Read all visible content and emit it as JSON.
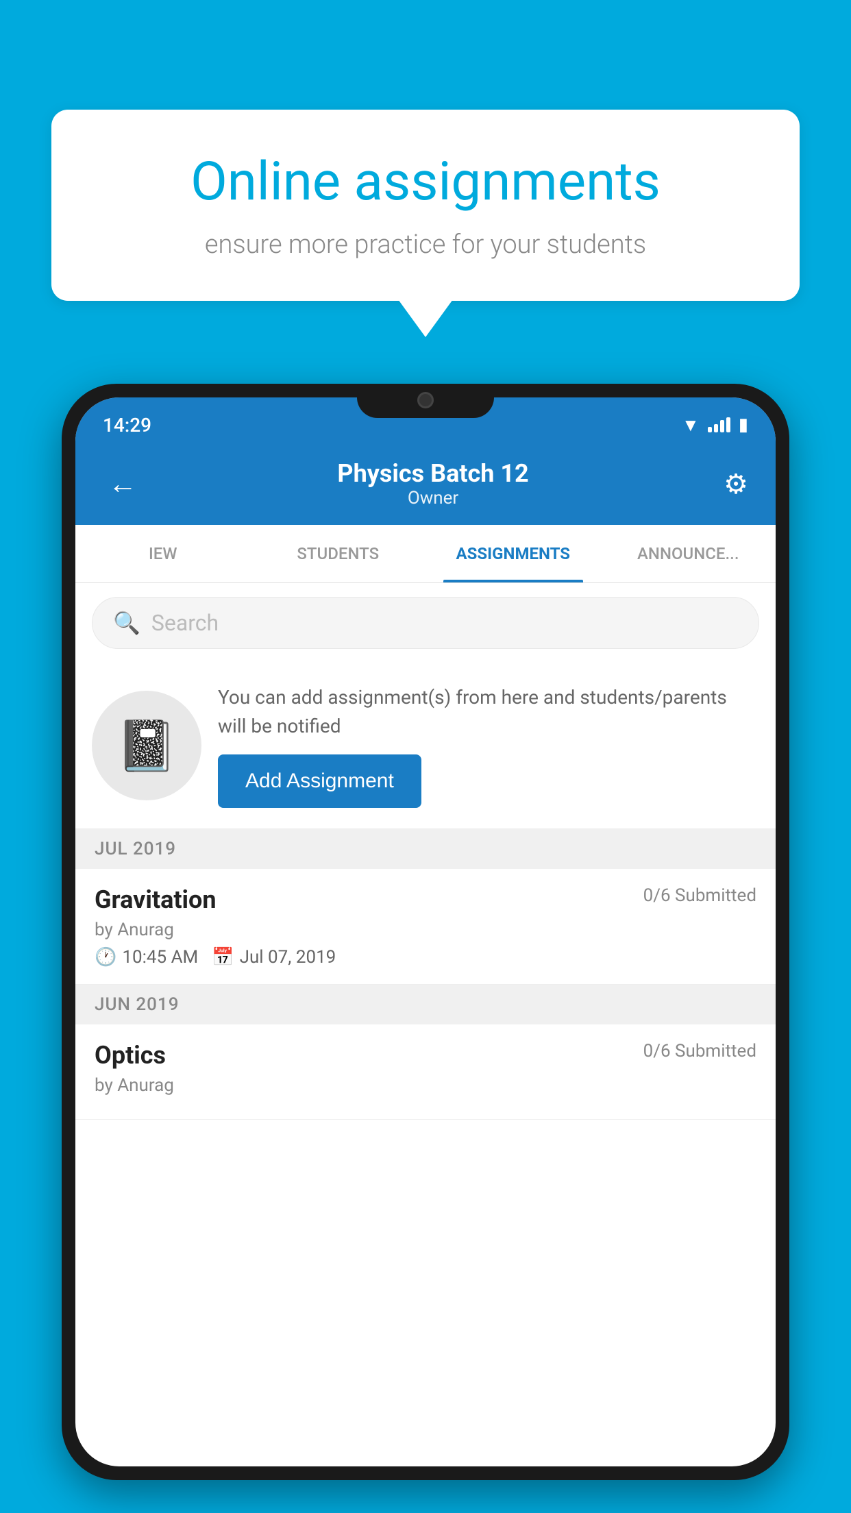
{
  "background_color": "#00AADD",
  "speech_bubble": {
    "title": "Online assignments",
    "subtitle": "ensure more practice for your students"
  },
  "status_bar": {
    "time": "14:29",
    "wifi": "▼",
    "battery": "🔋"
  },
  "header": {
    "title": "Physics Batch 12",
    "subtitle": "Owner",
    "back_label": "←",
    "settings_label": "⚙"
  },
  "tabs": [
    {
      "label": "IEW",
      "active": false
    },
    {
      "label": "STUDENTS",
      "active": false
    },
    {
      "label": "ASSIGNMENTS",
      "active": true
    },
    {
      "label": "ANNOUNCE...",
      "active": false
    }
  ],
  "search": {
    "placeholder": "Search"
  },
  "promo": {
    "text": "You can add assignment(s) from here and students/parents will be notified",
    "button_label": "Add Assignment"
  },
  "sections": [
    {
      "month": "JUL 2019",
      "assignments": [
        {
          "title": "Gravitation",
          "submitted": "0/6 Submitted",
          "author": "by Anurag",
          "time": "10:45 AM",
          "date": "Jul 07, 2019"
        }
      ]
    },
    {
      "month": "JUN 2019",
      "assignments": [
        {
          "title": "Optics",
          "submitted": "0/6 Submitted",
          "author": "by Anurag",
          "time": "",
          "date": ""
        }
      ]
    }
  ]
}
